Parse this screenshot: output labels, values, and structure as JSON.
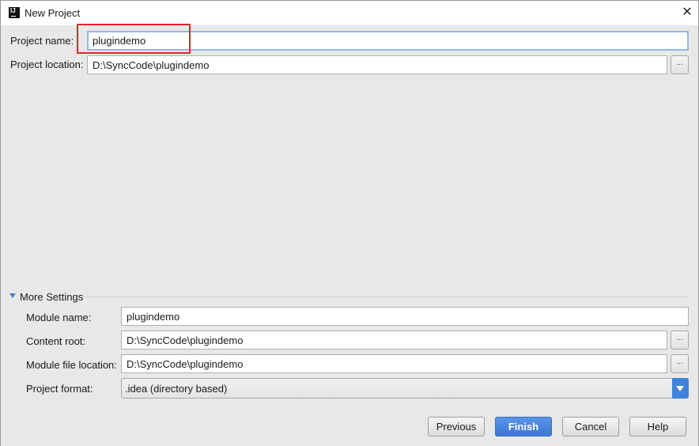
{
  "window": {
    "title": "New Project",
    "app_icon": "intellij-icon",
    "close_icon": "close-icon"
  },
  "project": {
    "name_label": "Project name:",
    "name_value": "plugindemo",
    "location_label": "Project location:",
    "location_value": "D:\\SyncCode\\plugindemo",
    "browse_label": "..."
  },
  "more_settings": {
    "title": "More Settings",
    "expanded": true,
    "module_name_label": "Module name:",
    "module_name_value": "plugindemo",
    "content_root_label": "Content root:",
    "content_root_value": "D:\\SyncCode\\plugindemo",
    "module_file_label": "Module file location:",
    "module_file_value": "D:\\SyncCode\\plugindemo",
    "format_label": "Project format:",
    "format_value": ".idea (directory based)"
  },
  "buttons": {
    "previous": "Previous",
    "finish": "Finish",
    "cancel": "Cancel",
    "help": "Help"
  },
  "colors": {
    "accent": "#3f82dc",
    "highlight": "#e8212b"
  }
}
